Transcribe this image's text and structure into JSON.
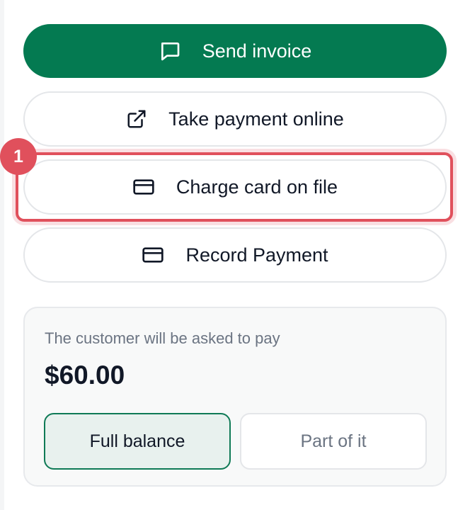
{
  "actions": {
    "send_invoice": "Send invoice",
    "take_payment_online": "Take payment online",
    "charge_card_on_file": "Charge card on file",
    "record_payment": "Record Payment"
  },
  "annotation": {
    "step_number": "1"
  },
  "payment": {
    "note": "The customer will be asked to pay",
    "amount": "$60.00",
    "options": [
      {
        "label": "Full balance",
        "selected": true
      },
      {
        "label": "Part of it",
        "selected": false
      }
    ]
  },
  "colors": {
    "primary": "#047a51",
    "highlight": "#e0505c",
    "selected_bg": "#e8f1ee"
  },
  "icons": {
    "send_invoice": "message-square-icon",
    "take_payment_online": "external-link-icon",
    "charge_card_on_file": "credit-card-icon",
    "record_payment": "credit-card-icon"
  }
}
